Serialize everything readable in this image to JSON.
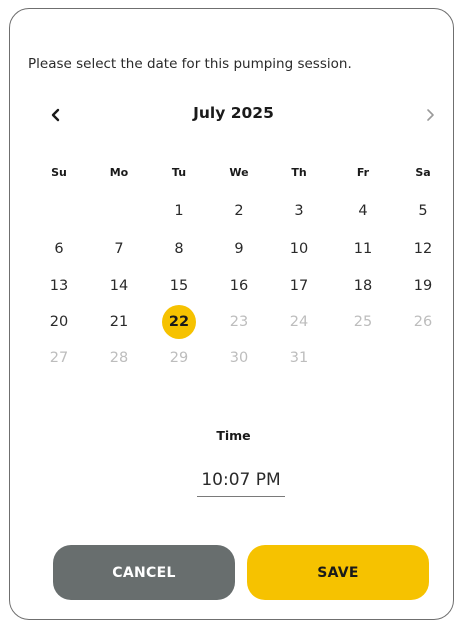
{
  "dialog": {
    "prompt": "Please select the date for this pumping session.",
    "prev_icon": "chevron-left-icon",
    "next_icon": "chevron-right-icon",
    "month_title": "July 2025"
  },
  "calendar": {
    "weekdays": [
      "Su",
      "Mo",
      "Tu",
      "We",
      "Th",
      "Fr",
      "Sa"
    ],
    "weeks": [
      [
        null,
        null,
        "1",
        "2",
        "3",
        "4",
        "5"
      ],
      [
        "6",
        "7",
        "8",
        "9",
        "10",
        "11",
        "12"
      ],
      [
        "13",
        "14",
        "15",
        "16",
        "17",
        "18",
        "19"
      ],
      [
        "20",
        "21",
        "22",
        "23",
        "24",
        "25",
        "26"
      ],
      [
        "27",
        "28",
        "29",
        "30",
        "31",
        null,
        null
      ]
    ],
    "selected_day": "22",
    "disabled_days": [
      "23",
      "24",
      "25",
      "26",
      "27",
      "28",
      "29",
      "30",
      "31"
    ],
    "accent_color": "#f6c200"
  },
  "time": {
    "label": "Time",
    "value": "10:07 PM"
  },
  "buttons": {
    "cancel_label": "CANCEL",
    "save_label": "SAVE",
    "cancel_color": "#686e6e",
    "save_color": "#f6c200"
  }
}
